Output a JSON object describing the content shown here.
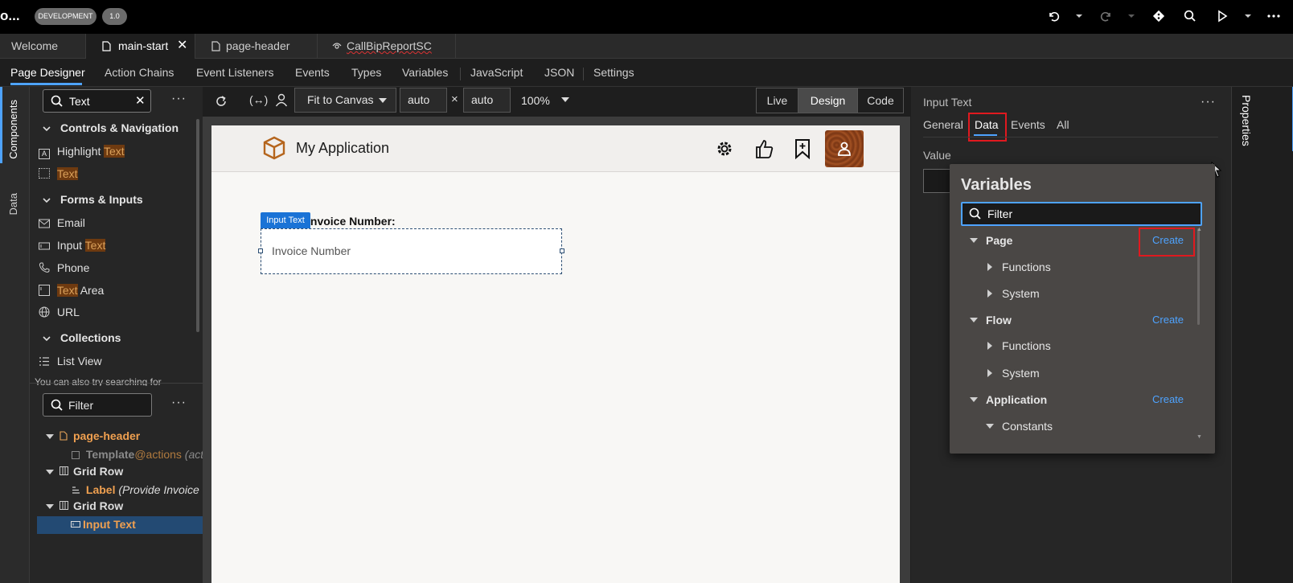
{
  "topbar": {
    "app_name": "o...",
    "env_badge": "DEVELOPMENT",
    "version_badge": "1.0",
    "icons": [
      "undo-icon",
      "redo-icon",
      "git-icon",
      "search-icon",
      "run-icon",
      "more-icon"
    ]
  },
  "file_tabs": [
    {
      "label": "Welcome"
    },
    {
      "label": "main-start",
      "active": true
    },
    {
      "label": "page-header"
    },
    {
      "label": "CallBipReportSC"
    }
  ],
  "designer_tabs": [
    "Page Designer",
    "Action Chains",
    "Event Listeners",
    "Events",
    "Types",
    "Variables",
    "JavaScript",
    "JSON",
    "Settings"
  ],
  "left_strip": {
    "components": "Components",
    "data": "Data"
  },
  "components": {
    "search_value": "Text",
    "groups": [
      {
        "title": "Controls & Navigation",
        "items": [
          {
            "pre": "Highlight ",
            "hl": "Text",
            "post": ""
          },
          {
            "pre": "",
            "hl": "Text",
            "post": ""
          }
        ]
      },
      {
        "title": "Forms & Inputs",
        "items": [
          {
            "pre": "Email",
            "hl": "",
            "post": ""
          },
          {
            "pre": "Input ",
            "hl": "Text",
            "post": ""
          },
          {
            "pre": "Phone",
            "hl": "",
            "post": ""
          },
          {
            "pre": "",
            "hl": "Text",
            "post": " Area"
          },
          {
            "pre": "URL",
            "hl": "",
            "post": ""
          }
        ]
      },
      {
        "title": "Collections",
        "items": [
          {
            "pre": "List View",
            "hl": "",
            "post": ""
          }
        ]
      }
    ],
    "hint": "You can also try searching for"
  },
  "structure": {
    "filter_placeholder": "Filter",
    "nodes": [
      {
        "label": "page-header",
        "suffix": ""
      },
      {
        "label": "Template",
        "suffix": "@actions",
        "note": "(acti"
      },
      {
        "label": "Grid Row",
        "suffix": ""
      },
      {
        "label": "Label",
        "suffix": "",
        "note": "(Provide Invoice Nu"
      },
      {
        "label": "Grid Row",
        "suffix": ""
      },
      {
        "label": "Input Text",
        "suffix": ""
      }
    ]
  },
  "canvas_toolbar": {
    "fit": "Fit to Canvas",
    "width": "auto",
    "height": "auto",
    "times": "×",
    "zoom": "100%",
    "modes": [
      "Live",
      "Design",
      "Code"
    ],
    "active_mode": "Design"
  },
  "page": {
    "app_title": "My Application",
    "field_tag": "Input Text",
    "field_label": "Invoice Number:",
    "field_placeholder": "Invoice Number"
  },
  "properties": {
    "title": "Input Text",
    "tabs": [
      "General",
      "Data",
      "Events",
      "All"
    ],
    "active_tab": "Data",
    "value_label": "Value",
    "strip_label": "Properties"
  },
  "variables_popup": {
    "title": "Variables",
    "filter_value": "Filter",
    "rows": [
      {
        "label": "Page",
        "level": 0,
        "expanded": true,
        "bold": true,
        "create": "Create"
      },
      {
        "label": "Functions",
        "level": 1,
        "expanded": false
      },
      {
        "label": "System",
        "level": 1,
        "expanded": false
      },
      {
        "label": "Flow",
        "level": 0,
        "expanded": true,
        "bold": true,
        "create": "Create"
      },
      {
        "label": "Functions",
        "level": 1,
        "expanded": false
      },
      {
        "label": "System",
        "level": 1,
        "expanded": false
      },
      {
        "label": "Application",
        "level": 0,
        "expanded": true,
        "bold": true,
        "create": "Create"
      },
      {
        "label": "Constants",
        "level": 1,
        "expanded": true
      }
    ]
  },
  "colors": {
    "accent": "#4ea3ff",
    "highlight_box": "#e0191f",
    "tag_blue": "#1a73d6",
    "search_highlight": "#6e3a10"
  }
}
